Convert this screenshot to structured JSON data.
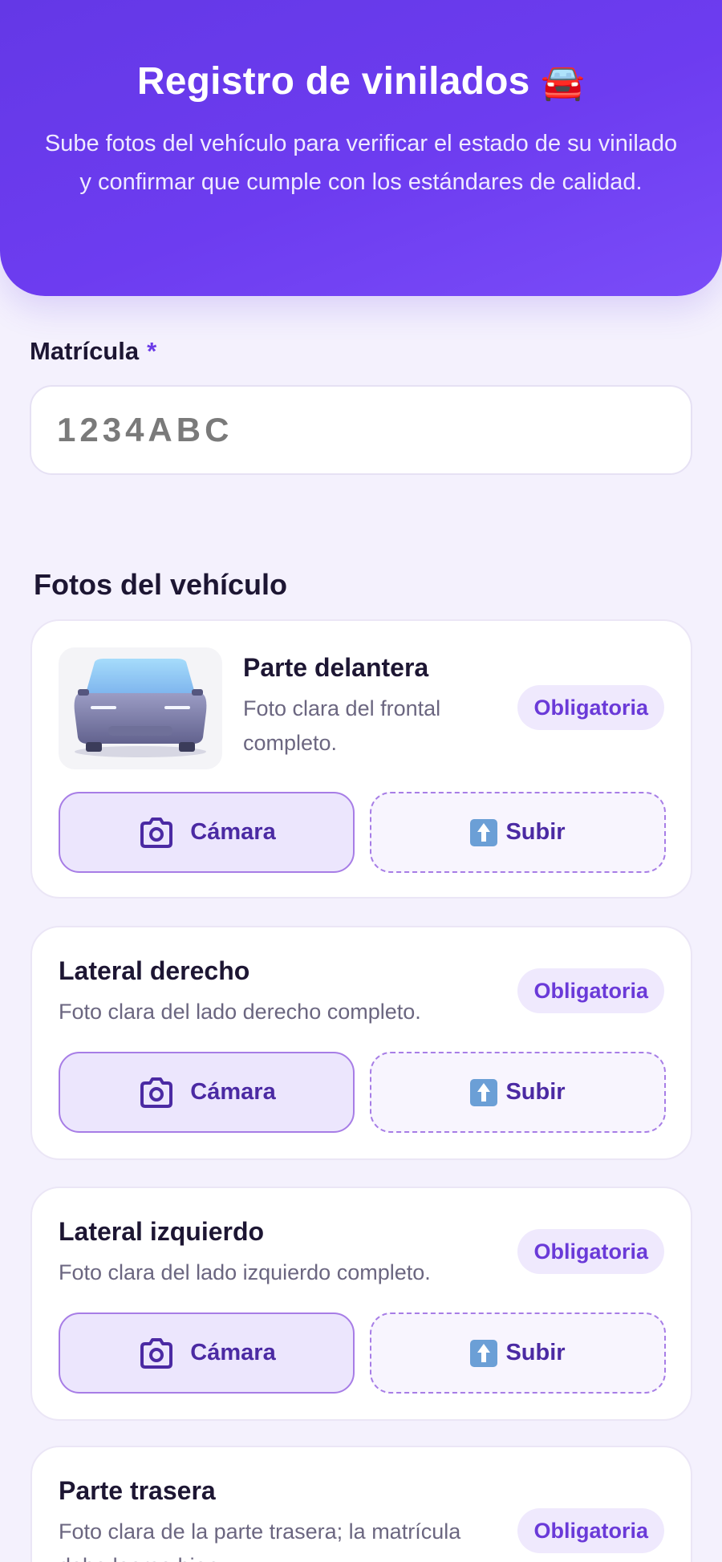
{
  "header": {
    "title": "Registro de vinilados",
    "title_emoji": "🚘",
    "subtitle": "Sube fotos del vehículo para verificar el estado de su vinilado y confirmar que cumple con los estándares de calidad."
  },
  "plate": {
    "label": "Matrícula",
    "required_mark": "*",
    "value": "",
    "placeholder": "1234ABC"
  },
  "photos": {
    "section_title": "Fotos del vehículo",
    "camera_label": "Cámara",
    "upload_label": "Subir",
    "items": [
      {
        "title": "Parte delantera",
        "description": "Foto clara del frontal completo.",
        "badge": "Obligatoria"
      },
      {
        "title": "Lateral derecho",
        "description": "Foto clara del lado derecho completo.",
        "badge": "Obligatoria"
      },
      {
        "title": "Lateral izquierdo",
        "description": "Foto clara del lado izquierdo completo.",
        "badge": "Obligatoria"
      },
      {
        "title": "Parte trasera",
        "description": "Foto clara de la parte trasera; la matrícula debe leerse bien.",
        "badge": "Obligatoria"
      }
    ]
  },
  "colors": {
    "accent": "#6c3ce8",
    "header_gradient_start": "#6438e6",
    "header_gradient_end": "#7a4cf8",
    "page_background": "#f4f1fd"
  }
}
